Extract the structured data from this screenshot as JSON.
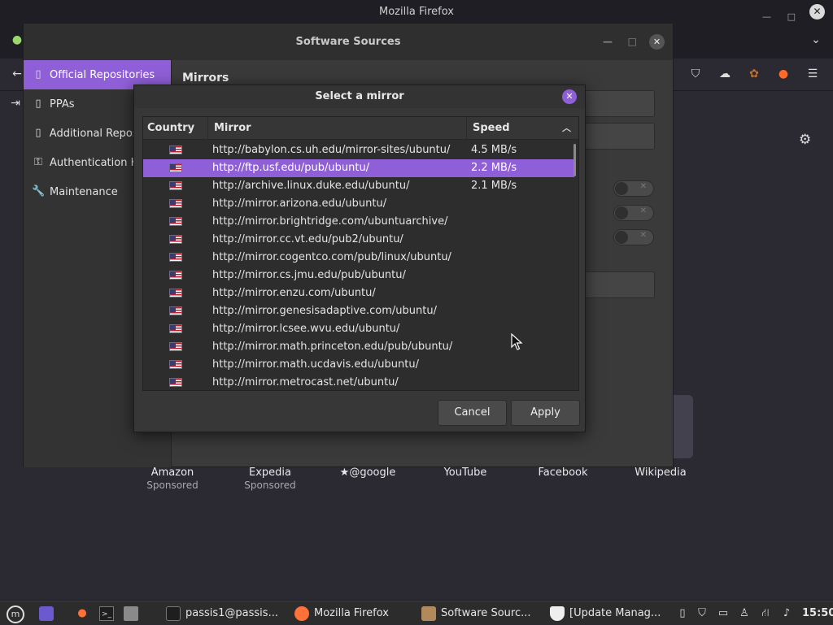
{
  "firefox": {
    "window_title": "Mozilla Firefox",
    "shortcuts": [
      {
        "name": "Amazon",
        "sub": "Sponsored"
      },
      {
        "name": "Expedia",
        "sub": "Sponsored"
      },
      {
        "name": "@google",
        "sub": ""
      },
      {
        "name": "YouTube",
        "sub": ""
      },
      {
        "name": "Facebook",
        "sub": ""
      },
      {
        "name": "Wikipedia",
        "sub": ""
      }
    ]
  },
  "software_sources": {
    "title": "Software Sources",
    "sidebar": [
      {
        "label": "Official Repositories",
        "icon": "repo-icon",
        "active": true
      },
      {
        "label": "PPAs",
        "icon": "ppa-icon",
        "active": false
      },
      {
        "label": "Additional Repositories",
        "icon": "repo-add-icon",
        "active": false
      },
      {
        "label": "Authentication Keys",
        "icon": "key-icon",
        "active": false
      },
      {
        "label": "Maintenance",
        "icon": "wrench-icon",
        "active": false
      }
    ],
    "mirrors_heading": "Mirrors"
  },
  "dialog": {
    "title": "Select a mirror",
    "columns": {
      "country": "Country",
      "mirror": "Mirror",
      "speed": "Speed"
    },
    "rows": [
      {
        "url": "http://babylon.cs.uh.edu/mirror-sites/ubuntu/",
        "speed": "4.5 MB/s",
        "selected": false
      },
      {
        "url": "http://ftp.usf.edu/pub/ubuntu/",
        "speed": "2.2 MB/s",
        "selected": true
      },
      {
        "url": "http://archive.linux.duke.edu/ubuntu/",
        "speed": "2.1 MB/s",
        "selected": false
      },
      {
        "url": "http://mirror.arizona.edu/ubuntu/",
        "speed": "",
        "selected": false
      },
      {
        "url": "http://mirror.brightridge.com/ubuntuarchive/",
        "speed": "",
        "selected": false
      },
      {
        "url": "http://mirror.cc.vt.edu/pub2/ubuntu/",
        "speed": "",
        "selected": false
      },
      {
        "url": "http://mirror.cogentco.com/pub/linux/ubuntu/",
        "speed": "",
        "selected": false
      },
      {
        "url": "http://mirror.cs.jmu.edu/pub/ubuntu/",
        "speed": "",
        "selected": false
      },
      {
        "url": "http://mirror.enzu.com/ubuntu/",
        "speed": "",
        "selected": false
      },
      {
        "url": "http://mirror.genesisadaptive.com/ubuntu/",
        "speed": "",
        "selected": false
      },
      {
        "url": "http://mirror.lcsee.wvu.edu/ubuntu/",
        "speed": "",
        "selected": false
      },
      {
        "url": "http://mirror.math.princeton.edu/pub/ubuntu/",
        "speed": "",
        "selected": false
      },
      {
        "url": "http://mirror.math.ucdavis.edu/ubuntu/",
        "speed": "",
        "selected": false
      },
      {
        "url": "http://mirror.metrocast.net/ubuntu/",
        "speed": "",
        "selected": false
      }
    ],
    "cancel_label": "Cancel",
    "apply_label": "Apply"
  },
  "taskbar": {
    "items": [
      {
        "label": "passis1@passis...",
        "icon": "terminal-icon"
      },
      {
        "label": "Mozilla Firefox",
        "icon": "firefox-icon"
      },
      {
        "label": "Software Sourc...",
        "icon": "software-sources-icon"
      },
      {
        "label": "[Update Manag...",
        "icon": "shield-icon"
      }
    ],
    "clock": "15:50"
  },
  "colors": {
    "accent": "#8f5fd8",
    "dialog_bg": "#373737",
    "list_bg": "#2d2d2d"
  }
}
